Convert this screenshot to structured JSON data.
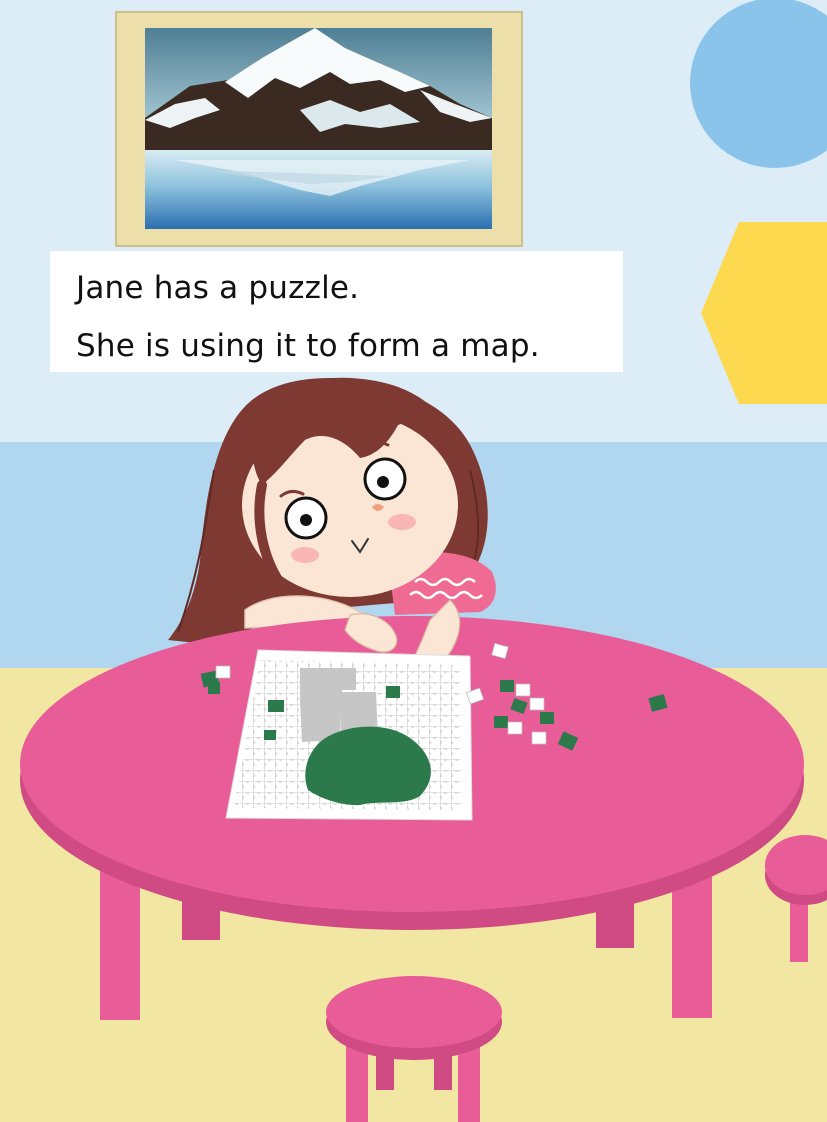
{
  "story": {
    "line1": "Jane has a puzzle.",
    "line2": "She is using it to form a map."
  },
  "colors": {
    "upper_wall": "#dcedf8",
    "lower_wall": "#b1d6ef",
    "floor": "#f2e7a2",
    "table": "#e85c97",
    "table_edge": "#d04b83",
    "circle_decoration": "#8bc4ea",
    "hexagon_decoration": "#fcd94e",
    "picture_frame": "#eddfa9",
    "hair": "#7e3a32",
    "dress": "#ef6b94",
    "puzzle_green": "#2c7a4b",
    "puzzle_gray": "#c6c6c6"
  },
  "icons": [
    "mountain-painting",
    "circle-decoration",
    "hexagon-decoration",
    "girl-jane",
    "jigsaw-puzzle-map",
    "round-table",
    "stool"
  ]
}
